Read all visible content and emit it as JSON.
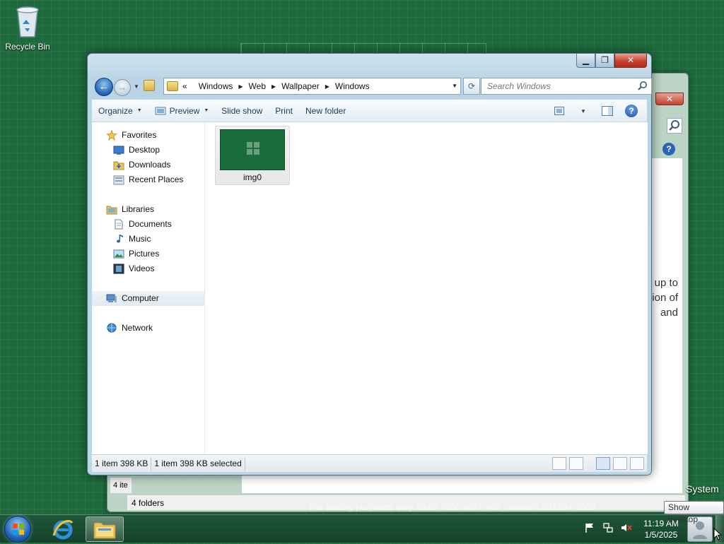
{
  "desktop": {
    "recycle_bin_label": "Recycle Bin"
  },
  "back_window": {
    "status": "4 folders",
    "status_partial": "4 ite",
    "text_lines": [
      "up to",
      "ion of",
      "and"
    ],
    "system_label": "System",
    "help_symbol": "?",
    "close_symbol": "✕"
  },
  "watermark": "For testing purposes only. Build 7000.win7_m3_winmain.081204-2000",
  "window": {
    "minimize_symbol": "▁",
    "maximize_symbol": "❐",
    "close_symbol": "✕",
    "breadcrumb_prefix": "«",
    "breadcrumb": [
      "Windows",
      "Web",
      "Wallpaper",
      "Windows"
    ],
    "search_placeholder": "Search Windows",
    "toolbar": {
      "organize": "Organize",
      "preview": "Preview",
      "slide_show": "Slide show",
      "print": "Print",
      "new_folder": "New folder",
      "help_symbol": "?"
    },
    "nav": {
      "favorites": "Favorites",
      "desktop": "Desktop",
      "downloads": "Downloads",
      "recent_places": "Recent Places",
      "libraries": "Libraries",
      "documents": "Documents",
      "music": "Music",
      "pictures": "Pictures",
      "videos": "Videos",
      "computer": "Computer",
      "network": "Network"
    },
    "files": [
      {
        "name": "img0"
      }
    ],
    "status": {
      "items": "1 item 398 KB",
      "selected": "1 item 398 KB selected"
    }
  },
  "taskbar": {
    "time": "11:19 AM",
    "date": "1/5/2025",
    "tooltip": "Show desktop"
  },
  "colors": {
    "desktop_background": "#1e6a3c",
    "accent_blue": "#1f5fb4",
    "close_red": "#c5432e"
  }
}
